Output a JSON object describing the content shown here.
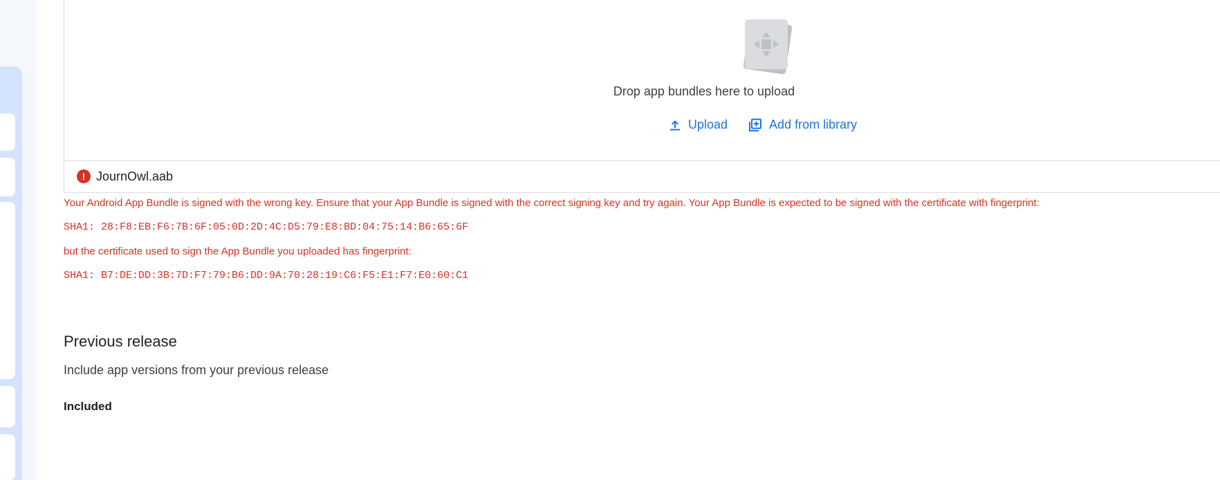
{
  "upload": {
    "drop_text": "Drop app bundles here to upload",
    "upload_label": "Upload",
    "library_label": "Add from library"
  },
  "file": {
    "name": "JournOwl.aab",
    "status_icon": "error-icon"
  },
  "error": {
    "message": "Your Android App Bundle is signed with the wrong key. Ensure that your App Bundle is signed with the correct signing key and try again. Your App Bundle is expected to be signed with the certificate with fingerprint:",
    "expected_fingerprint": "SHA1: 28:F8:EB:F6:7B:6F:05:0D:2D:4C:D5:79:E8:BD:04:75:14:B6:65:6F",
    "uploaded_intro": "but the certificate used to sign the App Bundle you uploaded has fingerprint:",
    "uploaded_fingerprint": "SHA1: B7:DE:DD:3B:7D:F7:79:B6:DD:9A:70:28:19:C6:F5:E1:F7:E0:60:C1"
  },
  "previous_release": {
    "title": "Previous release",
    "description": "Include app versions from your previous release",
    "status": "Included"
  },
  "colors": {
    "accent": "#1a73e8",
    "error": "#d93025",
    "rail": "#d3e3fd"
  }
}
